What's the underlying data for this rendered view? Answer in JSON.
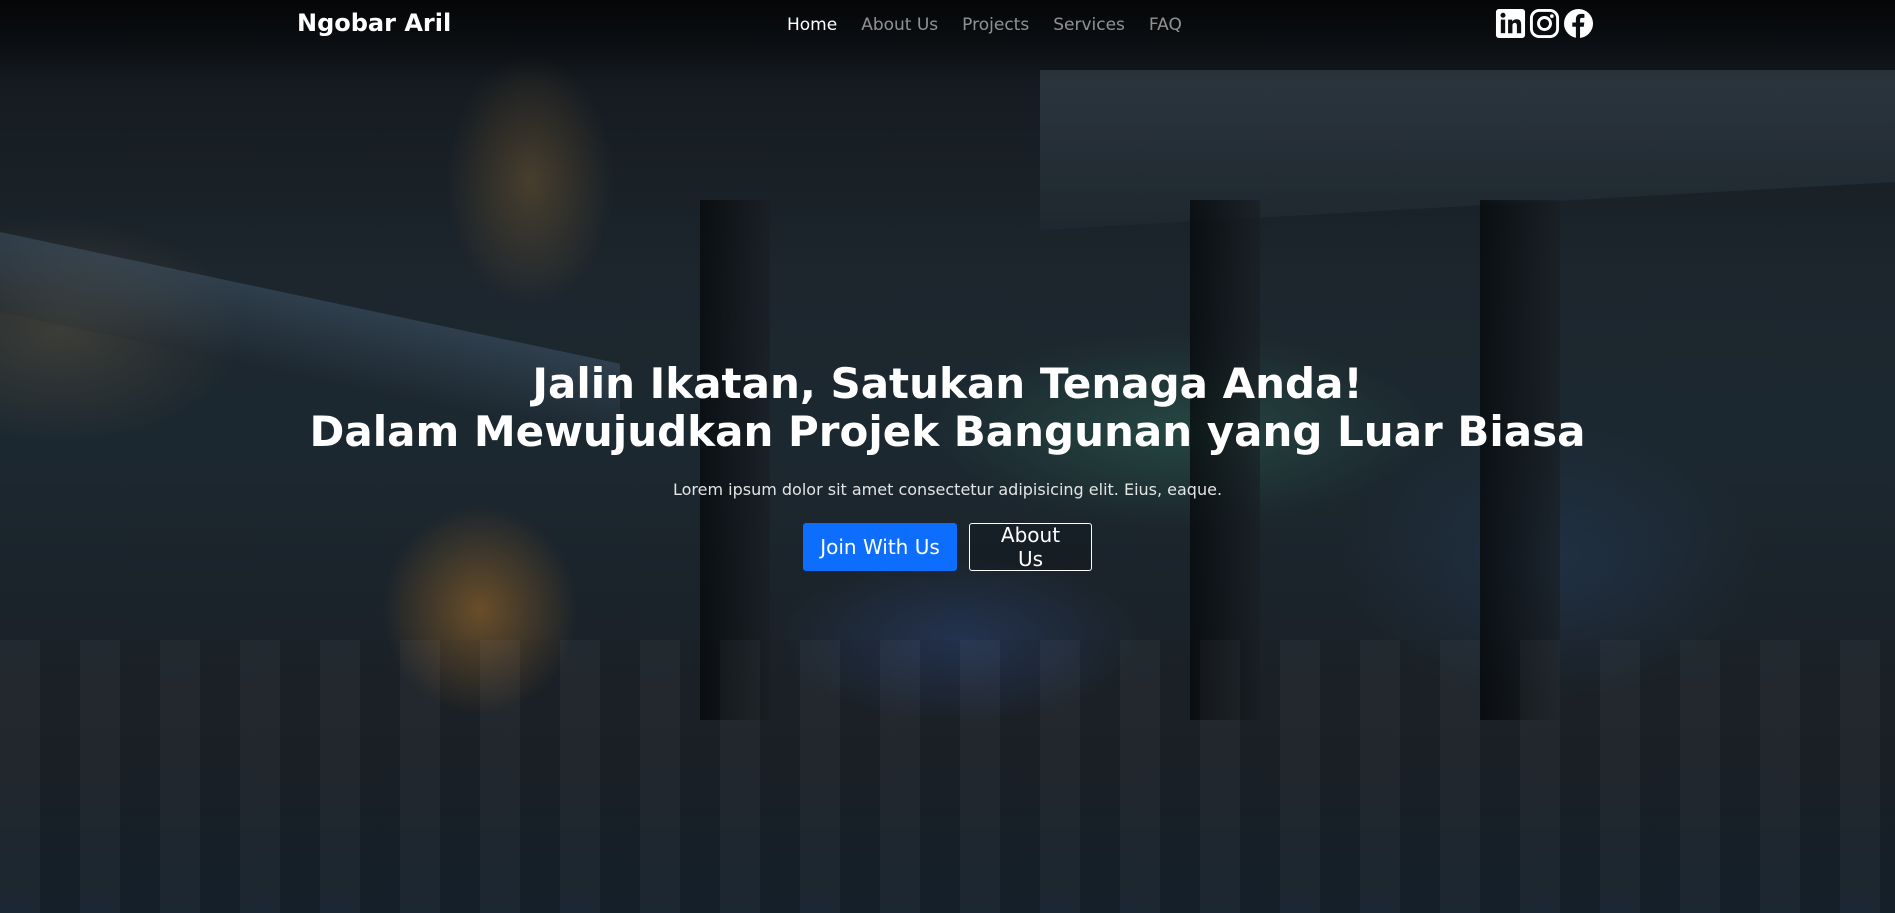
{
  "navbar": {
    "brand": "Ngobar Aril",
    "links": [
      {
        "label": "Home",
        "active": true
      },
      {
        "label": "About Us",
        "active": false
      },
      {
        "label": "Projects",
        "active": false
      },
      {
        "label": "Services",
        "active": false
      },
      {
        "label": "FAQ",
        "active": false
      }
    ],
    "socials": [
      "linkedin-icon",
      "instagram-icon",
      "facebook-icon"
    ]
  },
  "hero": {
    "title_line1": "Jalin Ikatan, Satukan Tenaga Anda!",
    "title_line2": "Dalam Mewujudkan Projek Bangunan yang Luar Biasa",
    "subtitle": "Lorem ipsum dolor sit amet consectetur adipisicing elit. Eius, eaque.",
    "primary_button": "Join With Us",
    "secondary_button": "About Us"
  },
  "colors": {
    "primary": "#0d6efd",
    "text": "#ffffff",
    "nav_muted": "rgba(255,255,255,0.55)"
  }
}
